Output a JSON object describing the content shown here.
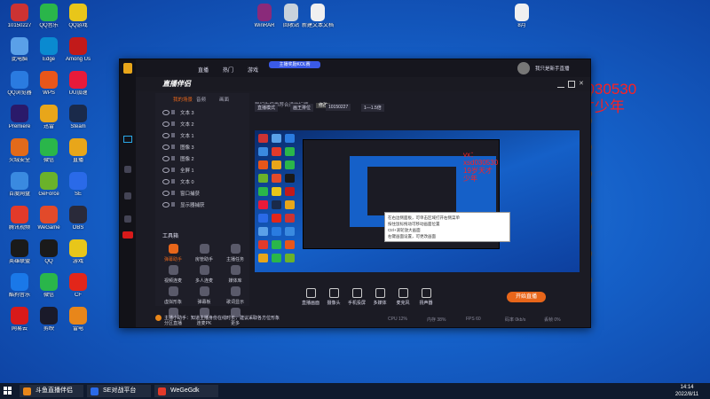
{
  "desktop": {
    "icons": [
      {
        "label": "10150227",
        "color": "#c33"
      },
      {
        "label": "此电脑",
        "color": "#5aa0e8"
      },
      {
        "label": "QQ浏览器",
        "color": "#2a7be0"
      },
      {
        "label": "Premiere",
        "color": "#2a1a6a"
      },
      {
        "label": "火绒安全",
        "color": "#e26a1a"
      },
      {
        "label": "百度网盘",
        "color": "#3a8ae0"
      },
      {
        "label": "腾讯视频",
        "color": "#e23a2a"
      },
      {
        "label": "英雄联盟",
        "color": "#1a1a1a"
      },
      {
        "label": "酷狗音乐",
        "color": "#1a78e8"
      },
      {
        "label": "网易云",
        "color": "#d81a1a"
      },
      {
        "label": "QQ音乐",
        "color": "#2ab64a"
      },
      {
        "label": "Edge",
        "color": "#0a8ad0"
      },
      {
        "label": "WPS",
        "color": "#e8561a"
      },
      {
        "label": "迅雷",
        "color": "#e8a61a"
      },
      {
        "label": "微信",
        "color": "#2ab64a"
      },
      {
        "label": "GeForce",
        "color": "#6ab22a"
      },
      {
        "label": "WeGame",
        "color": "#e24a2a"
      },
      {
        "label": "QQ",
        "color": "#1a1a1a"
      },
      {
        "label": "微信",
        "color": "#2ab64a"
      },
      {
        "label": "剪映",
        "color": "#1a1a2a"
      },
      {
        "label": "QQ游戏",
        "color": "#e8c61a"
      },
      {
        "label": "Among Us",
        "color": "#c21a1a"
      },
      {
        "label": "UU加速",
        "color": "#e81a3a"
      },
      {
        "label": "Steam",
        "color": "#1a2a4a"
      },
      {
        "label": "直播",
        "color": "#e8a61a"
      },
      {
        "label": "SE",
        "color": "#2a6ae8"
      },
      {
        "label": "OBS",
        "color": "#2a2a3a"
      },
      {
        "label": "游戏",
        "color": "#e8c61a"
      },
      {
        "label": "CF",
        "color": "#e2261a"
      },
      {
        "label": "雷电",
        "color": "#e8861a"
      }
    ],
    "top_icons": [
      {
        "label": "WinRAR",
        "color": "#8a2a7a"
      },
      {
        "label": "回收站",
        "color": "#c8d2dc"
      },
      {
        "label": "新建文本文档",
        "color": "#f0f0f0"
      },
      {
        "label": "8月",
        "color": "#f0f0f0"
      }
    ]
  },
  "overlay": {
    "line1": "vx：xsd030530",
    "line2": "19岁天才少年",
    "color": "#ff2020"
  },
  "app": {
    "tabs": [
      "直播",
      "热门",
      "游戏"
    ],
    "promo": "主播奖励KOL赛",
    "logo": "直播伴侣",
    "open_label": "我只是新手直播",
    "scene_tabs": [
      "我的场景",
      "音频",
      "画面"
    ],
    "sources": [
      "文本 3",
      "文本 2",
      "文本 1",
      "图像 3",
      "图像 2",
      "全屏 1",
      "文本 0",
      "窗口捕获",
      "显示器捕获"
    ],
    "tools_title": "工具箱",
    "tools": [
      "弹幕助手",
      "房管助手",
      "主播任务",
      "视频连麦",
      "多人连麦",
      "媒体库",
      "虚拟形象",
      "弹幕板",
      "歌词显示",
      "分区直播",
      "连麦PK",
      "更多"
    ],
    "notice": "主播小助手：知道主播身份在线时长，建议采取各方位形象",
    "title_hint": "我们为您推荐合适的标题",
    "title_btn": "修改",
    "toolbar_items": [
      "直播模式",
      "画王排位",
      "10150227",
      "1—1.5倍"
    ],
    "bottom_controls": [
      "直播画面",
      "摄像头",
      "手机投屏",
      "多媒体",
      "麦克风",
      "扬声器"
    ],
    "live_button": "开始直播",
    "status": [
      "CPU 12%",
      "内存 38%",
      "FPS 60",
      "码率 0kb/s",
      "丢帧 0%"
    ],
    "nested": {
      "tooltip_lines": [
        "在右边侧面板，可单击区域打开右侧菜单",
        "按住鼠标拖动可移动画面位置",
        "Ctrl+滚轮放大画面",
        "右键画面设置，可更改画面"
      ]
    }
  },
  "taskbar": {
    "items": [
      {
        "label": "斗鱼直播伴侣",
        "color": "#e8861a"
      },
      {
        "label": "SE对战平台",
        "color": "#2a6ae8"
      },
      {
        "label": "WeGeGdk",
        "color": "#e23a2a"
      }
    ],
    "time": "14:14",
    "date": "2022/8/11"
  }
}
